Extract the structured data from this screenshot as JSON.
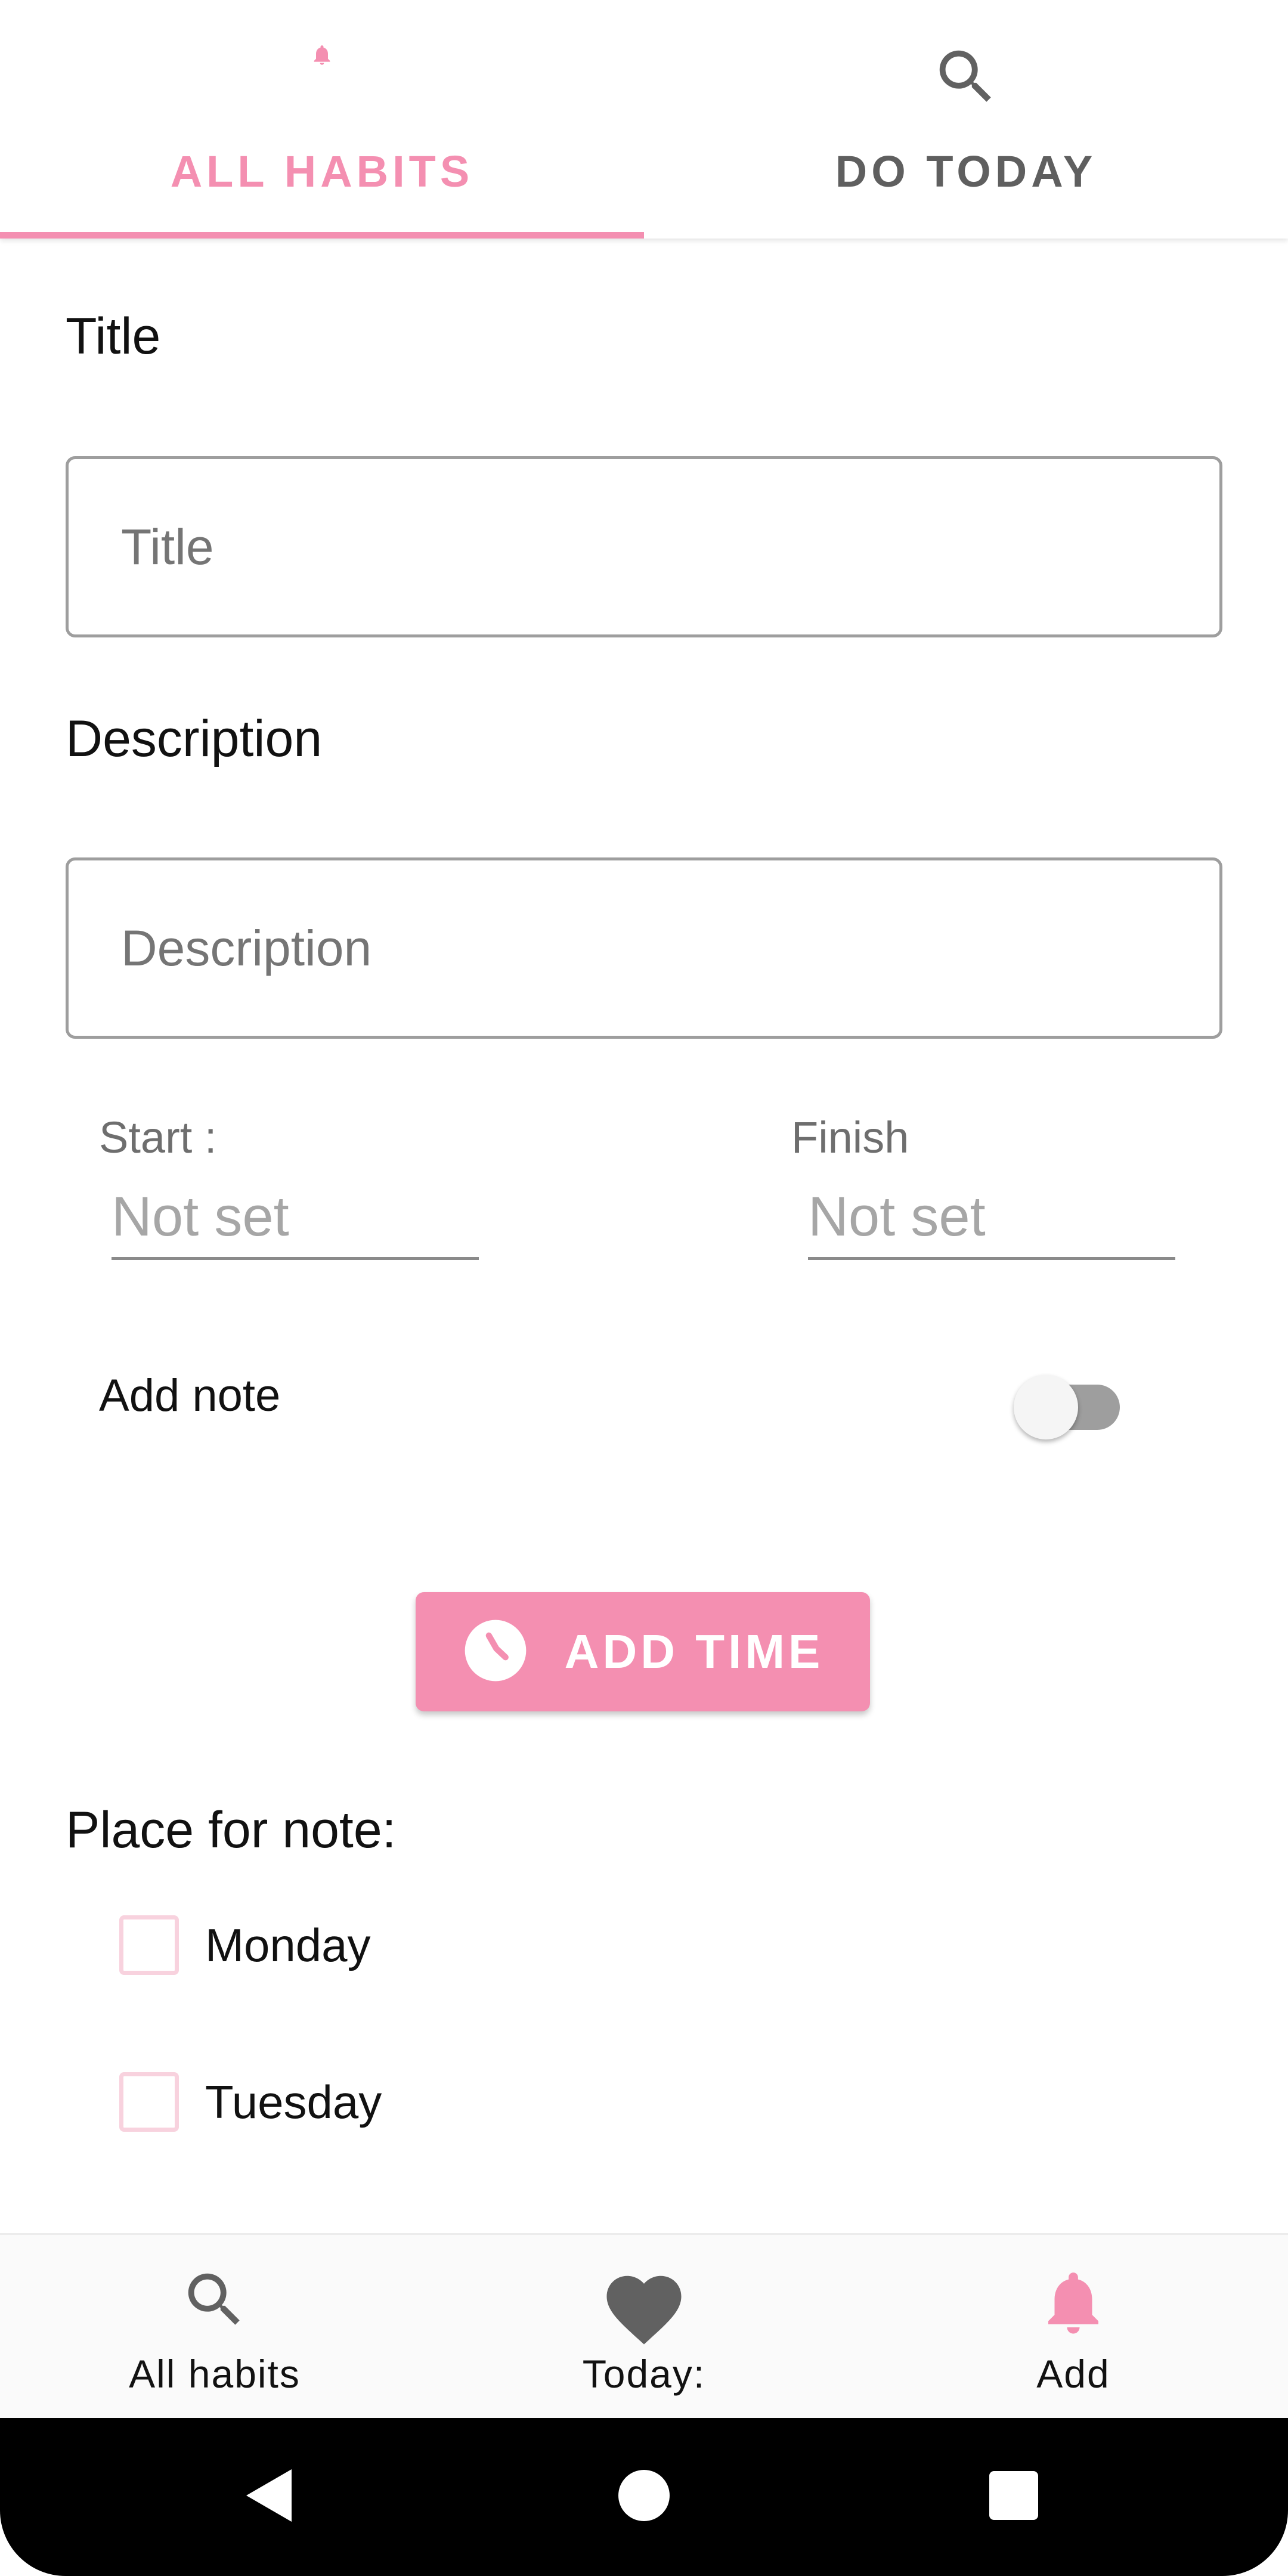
{
  "tabs": [
    {
      "label": "ALL HABITS",
      "icon": "bell-icon",
      "active": true
    },
    {
      "label": "DO TODAY",
      "icon": "search-icon",
      "active": false
    }
  ],
  "form": {
    "title_label": "Title",
    "title_placeholder": "Title",
    "description_label": "Description",
    "description_placeholder": "Description",
    "start_label": "Start :",
    "start_placeholder": "Not set",
    "finish_label": "Finish",
    "finish_placeholder": "Not set",
    "add_note_label": "Add note",
    "add_note_enabled": false,
    "add_time_label": "ADD TIME",
    "place_for_note_label": "Place for note:",
    "days": [
      {
        "label": "Monday",
        "checked": false
      },
      {
        "label": "Tuesday",
        "checked": false
      }
    ]
  },
  "bottom_nav": [
    {
      "label": "All habits",
      "icon": "search-icon"
    },
    {
      "label": "Today:",
      "icon": "heart-icon"
    },
    {
      "label": "Add",
      "icon": "bell-icon"
    }
  ],
  "system_nav": {
    "icons": [
      "back-icon",
      "home-icon",
      "recents-icon"
    ]
  },
  "colors": {
    "accent": "#f48fb1",
    "icon_gray": "#616161",
    "checkbox_border": "#f8d2de",
    "system_bar": "#000000"
  }
}
